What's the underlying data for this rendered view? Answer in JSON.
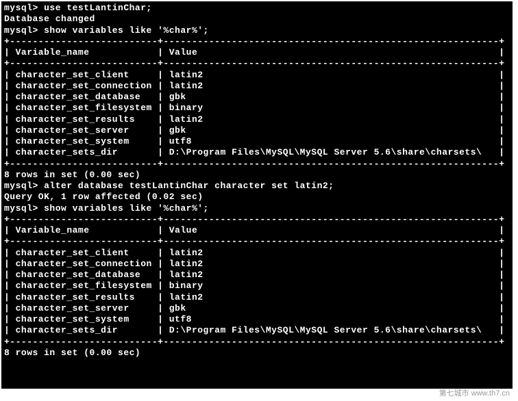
{
  "terminal": {
    "prompt": "mysql>",
    "cmd1": "use testLantinChar;",
    "resp1": "Database changed",
    "cmd2": "show variables like '%char%';",
    "header_var": "Variable_name",
    "header_val": "Value",
    "table1": {
      "rows": [
        {
          "var": "character_set_client",
          "val": "latin2"
        },
        {
          "var": "character_set_connection",
          "val": "latin2"
        },
        {
          "var": "character_set_database",
          "val": "gbk"
        },
        {
          "var": "character_set_filesystem",
          "val": "binary"
        },
        {
          "var": "character_set_results",
          "val": "latin2"
        },
        {
          "var": "character_set_server",
          "val": "gbk"
        },
        {
          "var": "character_set_system",
          "val": "utf8"
        },
        {
          "var": "character_sets_dir",
          "val": "D:\\Program Files\\MySQL\\MySQL Server 5.6\\share\\charsets\\"
        }
      ]
    },
    "result1": "8 rows in set (0.00 sec)",
    "cmd3": "alter database testLantinChar character set latin2;",
    "resp3": "Query OK, 1 row affected (0.02 sec)",
    "cmd4": "show variables like '%char%';",
    "table2": {
      "rows": [
        {
          "var": "character_set_client",
          "val": "latin2"
        },
        {
          "var": "character_set_connection",
          "val": "latin2"
        },
        {
          "var": "character_set_database",
          "val": "latin2"
        },
        {
          "var": "character_set_filesystem",
          "val": "binary"
        },
        {
          "var": "character_set_results",
          "val": "latin2"
        },
        {
          "var": "character_set_server",
          "val": "gbk"
        },
        {
          "var": "character_set_system",
          "val": "utf8"
        },
        {
          "var": "character_sets_dir",
          "val": "D:\\Program Files\\MySQL\\MySQL Server 5.6\\share\\charsets\\"
        }
      ]
    },
    "result2": "8 rows in set (0.00 sec)"
  },
  "watermark": "第七城市  www.th7.cn",
  "layout": {
    "col1_width": 24,
    "col2_width": 57
  }
}
